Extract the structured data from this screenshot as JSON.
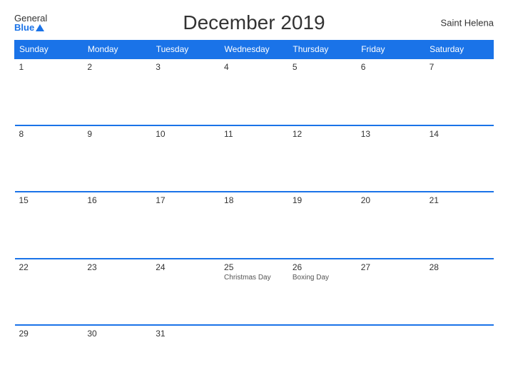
{
  "header": {
    "logo_general": "General",
    "logo_blue": "Blue",
    "title": "December 2019",
    "region": "Saint Helena"
  },
  "calendar": {
    "weekdays": [
      "Sunday",
      "Monday",
      "Tuesday",
      "Wednesday",
      "Thursday",
      "Friday",
      "Saturday"
    ],
    "weeks": [
      [
        {
          "day": "1",
          "event": ""
        },
        {
          "day": "2",
          "event": ""
        },
        {
          "day": "3",
          "event": ""
        },
        {
          "day": "4",
          "event": ""
        },
        {
          "day": "5",
          "event": ""
        },
        {
          "day": "6",
          "event": ""
        },
        {
          "day": "7",
          "event": ""
        }
      ],
      [
        {
          "day": "8",
          "event": ""
        },
        {
          "day": "9",
          "event": ""
        },
        {
          "day": "10",
          "event": ""
        },
        {
          "day": "11",
          "event": ""
        },
        {
          "day": "12",
          "event": ""
        },
        {
          "day": "13",
          "event": ""
        },
        {
          "day": "14",
          "event": ""
        }
      ],
      [
        {
          "day": "15",
          "event": ""
        },
        {
          "day": "16",
          "event": ""
        },
        {
          "day": "17",
          "event": ""
        },
        {
          "day": "18",
          "event": ""
        },
        {
          "day": "19",
          "event": ""
        },
        {
          "day": "20",
          "event": ""
        },
        {
          "day": "21",
          "event": ""
        }
      ],
      [
        {
          "day": "22",
          "event": ""
        },
        {
          "day": "23",
          "event": ""
        },
        {
          "day": "24",
          "event": ""
        },
        {
          "day": "25",
          "event": "Christmas Day"
        },
        {
          "day": "26",
          "event": "Boxing Day"
        },
        {
          "day": "27",
          "event": ""
        },
        {
          "day": "28",
          "event": ""
        }
      ],
      [
        {
          "day": "29",
          "event": ""
        },
        {
          "day": "30",
          "event": ""
        },
        {
          "day": "31",
          "event": ""
        },
        {
          "day": "",
          "event": ""
        },
        {
          "day": "",
          "event": ""
        },
        {
          "day": "",
          "event": ""
        },
        {
          "day": "",
          "event": ""
        }
      ]
    ]
  }
}
